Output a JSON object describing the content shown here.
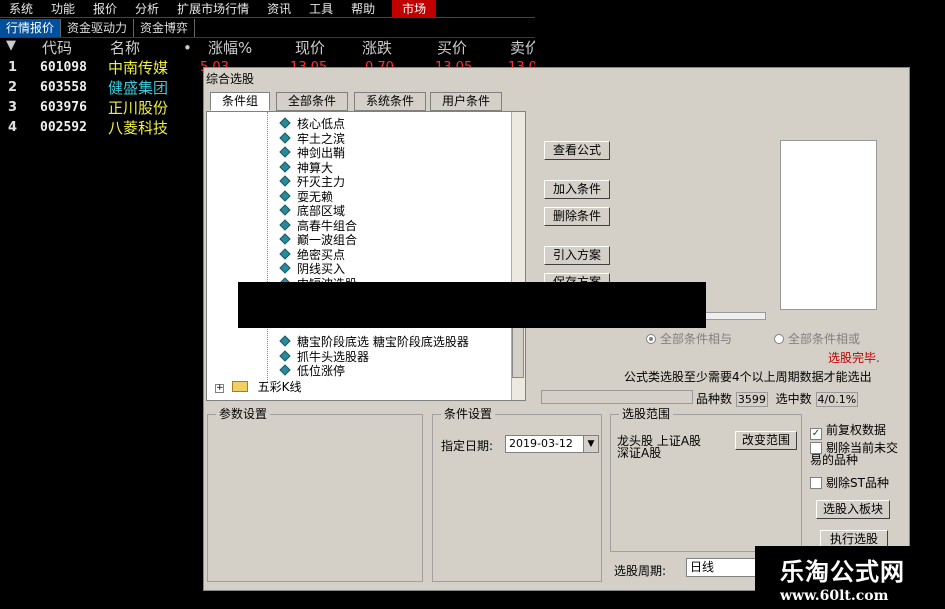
{
  "menu": [
    "系统",
    "功能",
    "报价",
    "分析",
    "扩展市场行情",
    "资讯",
    "工具",
    "帮助"
  ],
  "menu_market": "市场",
  "subtabs": [
    "行情报价",
    "资金驱动力",
    "资金博弈"
  ],
  "quote_headers": [
    "代码",
    "名称",
    "•",
    "涨幅%",
    "现价",
    "涨跌",
    "买价",
    "卖价"
  ],
  "quotes": [
    {
      "idx": "1",
      "code": "601098",
      "name": "中南传媒"
    },
    {
      "idx": "2",
      "code": "603558",
      "name": "健盛集团"
    },
    {
      "idx": "3",
      "code": "603976",
      "name": "正川股份"
    },
    {
      "idx": "4",
      "code": "002592",
      "name": "八菱科技"
    }
  ],
  "quote_row1_partial": [
    "1",
    "5.03",
    "13.05",
    "0.70",
    "13.05",
    "13.0"
  ],
  "dialog": {
    "title": "综合选股",
    "tabs": [
      "条件组",
      "全部条件",
      "系统条件",
      "用户条件"
    ],
    "tree_items": [
      "核心低点",
      "牢土之滨",
      "神剑出鞘",
      "神算大",
      "歼灭主力",
      "耍无赖",
      "底部区域",
      "高春牛组合",
      "巅一波组合",
      "绝密买点",
      "阴线买入",
      "中短波选股"
    ],
    "tree_items_lower": [
      "糖宝阶段底选  糖宝阶段底选股器",
      "抓牛头选股器",
      "低位涨停"
    ],
    "tree_folder": "五彩K线",
    "buttons": [
      "查看公式",
      "加入条件",
      "删除条件",
      "引入方案",
      "保存方案"
    ],
    "radio_all_and": "全部条件相与",
    "radio_all_or": "全部条件相或",
    "status": "选股完毕.",
    "notice": "公式类选股至少需要4个以上周期数据才能选出",
    "count_label": "品种数",
    "count_value": "3599",
    "selected_label": "选中数",
    "selected_value": "4/0.1%",
    "param_group": "参数设置",
    "cond_group": "条件设置",
    "date_label": "指定日期:",
    "date_value": "2019-03-12",
    "range_group": "选股范围",
    "range_text_1": "龙头股 上证A股",
    "range_text_2": "深证A股",
    "change_range": "改变范围",
    "chk_fq": "前复权数据",
    "chk_exclude_untraded": "剔除当前未交易的品种",
    "chk_exclude_st": "剔除ST品种",
    "btn_to_block": "选股入板块",
    "btn_execute": "执行选股",
    "period_label": "选股周期:",
    "period_value": "日线"
  },
  "watermark": {
    "title": "乐淘公式网",
    "url": "www.60lt.com"
  }
}
